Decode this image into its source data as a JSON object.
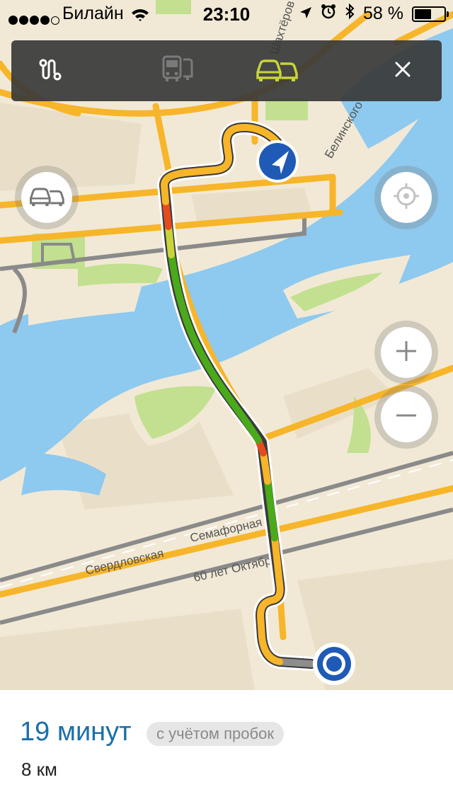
{
  "status_bar": {
    "carrier": "Билайн",
    "time": "23:10",
    "battery": "58 %",
    "battery_level": 0.58,
    "signal_bars": 4
  },
  "transport_modes": [
    {
      "name": "route-options",
      "icon": "route-icon",
      "active": false
    },
    {
      "name": "public-transport",
      "icon": "bus-icon",
      "active": false
    },
    {
      "name": "car-traffic",
      "icon": "cars-icon",
      "active": true
    }
  ],
  "close_icon": "close-icon",
  "map": {
    "streets": [
      "Шахтёров",
      "Белинского",
      "Свердловская",
      "Семафорная",
      "60 лет Октября"
    ]
  },
  "controls": {
    "traffic_icon": "traffic-icon",
    "locate_icon": "crosshair-icon",
    "zoom_in": "+",
    "zoom_out": "−"
  },
  "route": {
    "duration": "19 минут",
    "traffic_note": "с учётом пробок",
    "distance": "8 км"
  },
  "colors": {
    "accent": "#1b6fa8",
    "active_mode": "#c8d43a",
    "water": "#8ec9ef",
    "park": "#c2e08f",
    "road": "#f7b529",
    "jam": "#e34c1e",
    "free": "#4aaa1a"
  }
}
